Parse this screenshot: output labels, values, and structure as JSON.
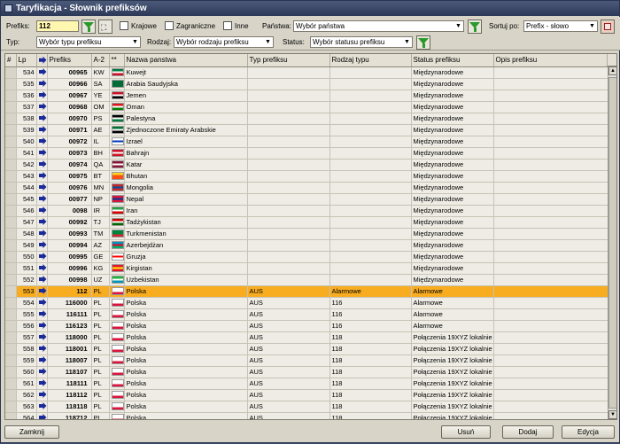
{
  "window": {
    "title": "Taryfikacja - Słownik prefiksów"
  },
  "filters": {
    "prefix_label": "Prefiks:",
    "prefix_value": "112",
    "krajowe_label": "Krajowe",
    "zagraniczne_label": "Zagraniczne",
    "inne_label": "Inne",
    "panstwa_label": "Państwa:",
    "panstwa_value": "Wybór państwa",
    "sortuj_label": "Sortuj po:",
    "sortuj_value": "Prefix - słowo",
    "typ_label": "Typ:",
    "typ_value": "Wybór typu prefiksu",
    "rodzaj_label": "Rodzaj:",
    "rodzaj_value": "Wybór rodzaju prefiksu",
    "status_label": "Status:",
    "status_value": "Wybór statusu prefiksu"
  },
  "table": {
    "columns": [
      "#",
      "Lp",
      "",
      "Prefiks",
      "A-2",
      "**",
      "Nazwa panstwa",
      "Typ prefiksu",
      "Rodzaj typu",
      "Status prefiksu",
      "Opis prefiksu"
    ],
    "rows": [
      {
        "lp": "534",
        "prefix": "00965",
        "a2": "KW",
        "flag": "kw",
        "country": "Kuwejt",
        "typ": "",
        "rodzaj": "",
        "status": "Międzynarodowe",
        "opis": ""
      },
      {
        "lp": "535",
        "prefix": "00966",
        "a2": "SA",
        "flag": "sa",
        "country": "Arabia Saudyjska",
        "typ": "",
        "rodzaj": "",
        "status": "Międzynarodowe",
        "opis": ""
      },
      {
        "lp": "536",
        "prefix": "00967",
        "a2": "YE",
        "flag": "ye",
        "country": "Jemen",
        "typ": "",
        "rodzaj": "",
        "status": "Międzynarodowe",
        "opis": ""
      },
      {
        "lp": "537",
        "prefix": "00968",
        "a2": "OM",
        "flag": "om",
        "country": "Oman",
        "typ": "",
        "rodzaj": "",
        "status": "Międzynarodowe",
        "opis": ""
      },
      {
        "lp": "538",
        "prefix": "00970",
        "a2": "PS",
        "flag": "ps",
        "country": "Palestyna",
        "typ": "",
        "rodzaj": "",
        "status": "Międzynarodowe",
        "opis": ""
      },
      {
        "lp": "539",
        "prefix": "00971",
        "a2": "AE",
        "flag": "ae",
        "country": "Zjednoczone Emiraty Arabskie",
        "typ": "",
        "rodzaj": "",
        "status": "Międzynarodowe",
        "opis": ""
      },
      {
        "lp": "540",
        "prefix": "00972",
        "a2": "IL",
        "flag": "il",
        "country": "Izrael",
        "typ": "",
        "rodzaj": "",
        "status": "Międzynarodowe",
        "opis": ""
      },
      {
        "lp": "541",
        "prefix": "00973",
        "a2": "BH",
        "flag": "bh",
        "country": "Bahrajn",
        "typ": "",
        "rodzaj": "",
        "status": "Międzynarodowe",
        "opis": ""
      },
      {
        "lp": "542",
        "prefix": "00974",
        "a2": "QA",
        "flag": "qa",
        "country": "Katar",
        "typ": "",
        "rodzaj": "",
        "status": "Międzynarodowe",
        "opis": ""
      },
      {
        "lp": "543",
        "prefix": "00975",
        "a2": "BT",
        "flag": "bt",
        "country": "Bhutan",
        "typ": "",
        "rodzaj": "",
        "status": "Międzynarodowe",
        "opis": ""
      },
      {
        "lp": "544",
        "prefix": "00976",
        "a2": "MN",
        "flag": "mn",
        "country": "Mongolia",
        "typ": "",
        "rodzaj": "",
        "status": "Międzynarodowe",
        "opis": ""
      },
      {
        "lp": "545",
        "prefix": "00977",
        "a2": "NP",
        "flag": "np",
        "country": "Nepal",
        "typ": "",
        "rodzaj": "",
        "status": "Międzynarodowe",
        "opis": ""
      },
      {
        "lp": "546",
        "prefix": "0098",
        "a2": "IR",
        "flag": "ir",
        "country": "Iran",
        "typ": "",
        "rodzaj": "",
        "status": "Międzynarodowe",
        "opis": ""
      },
      {
        "lp": "547",
        "prefix": "00992",
        "a2": "TJ",
        "flag": "tj",
        "country": "Tadżykistan",
        "typ": "",
        "rodzaj": "",
        "status": "Międzynarodowe",
        "opis": ""
      },
      {
        "lp": "548",
        "prefix": "00993",
        "a2": "TM",
        "flag": "tm",
        "country": "Turkmenistan",
        "typ": "",
        "rodzaj": "",
        "status": "Międzynarodowe",
        "opis": ""
      },
      {
        "lp": "549",
        "prefix": "00994",
        "a2": "AZ",
        "flag": "az",
        "country": "Azerbejdżan",
        "typ": "",
        "rodzaj": "",
        "status": "Międzynarodowe",
        "opis": ""
      },
      {
        "lp": "550",
        "prefix": "00995",
        "a2": "GE",
        "flag": "ge",
        "country": "Gruzja",
        "typ": "",
        "rodzaj": "",
        "status": "Międzynarodowe",
        "opis": ""
      },
      {
        "lp": "551",
        "prefix": "00996",
        "a2": "KG",
        "flag": "kg",
        "country": "Kirgistan",
        "typ": "",
        "rodzaj": "",
        "status": "Międzynarodowe",
        "opis": ""
      },
      {
        "lp": "552",
        "prefix": "00998",
        "a2": "UZ",
        "flag": "uz",
        "country": "Uzbekistan",
        "typ": "",
        "rodzaj": "",
        "status": "Międzynarodowe",
        "opis": ""
      },
      {
        "lp": "553",
        "prefix": "112",
        "a2": "PL",
        "flag": "pl",
        "country": "Polska",
        "typ": "AUS",
        "rodzaj": "Alarmowe",
        "status": "Alarmowe",
        "opis": "",
        "selected": true
      },
      {
        "lp": "554",
        "prefix": "116000",
        "a2": "PL",
        "flag": "pl",
        "country": "Polska",
        "typ": "AUS",
        "rodzaj": "116",
        "status": "Alarmowe",
        "opis": ""
      },
      {
        "lp": "555",
        "prefix": "116111",
        "a2": "PL",
        "flag": "pl",
        "country": "Polska",
        "typ": "AUS",
        "rodzaj": "116",
        "status": "Alarmowe",
        "opis": ""
      },
      {
        "lp": "556",
        "prefix": "116123",
        "a2": "PL",
        "flag": "pl",
        "country": "Polska",
        "typ": "AUS",
        "rodzaj": "116",
        "status": "Alarmowe",
        "opis": ""
      },
      {
        "lp": "557",
        "prefix": "118000",
        "a2": "PL",
        "flag": "pl",
        "country": "Polska",
        "typ": "AUS",
        "rodzaj": "118",
        "status": "Połączenia 19XYZ lokalnie",
        "opis": ""
      },
      {
        "lp": "558",
        "prefix": "118001",
        "a2": "PL",
        "flag": "pl",
        "country": "Polska",
        "typ": "AUS",
        "rodzaj": "118",
        "status": "Połączenia 19XYZ lokalnie",
        "opis": ""
      },
      {
        "lp": "559",
        "prefix": "118007",
        "a2": "PL",
        "flag": "pl",
        "country": "Polska",
        "typ": "AUS",
        "rodzaj": "118",
        "status": "Połączenia 19XYZ lokalnie",
        "opis": ""
      },
      {
        "lp": "560",
        "prefix": "118107",
        "a2": "PL",
        "flag": "pl",
        "country": "Polska",
        "typ": "AUS",
        "rodzaj": "118",
        "status": "Połączenia 19XYZ lokalnie",
        "opis": ""
      },
      {
        "lp": "561",
        "prefix": "118111",
        "a2": "PL",
        "flag": "pl",
        "country": "Polska",
        "typ": "AUS",
        "rodzaj": "118",
        "status": "Połączenia 19XYZ lokalnie",
        "opis": ""
      },
      {
        "lp": "562",
        "prefix": "118112",
        "a2": "PL",
        "flag": "pl",
        "country": "Polska",
        "typ": "AUS",
        "rodzaj": "118",
        "status": "Połączenia 19XYZ lokalnie",
        "opis": ""
      },
      {
        "lp": "563",
        "prefix": "118118",
        "a2": "PL",
        "flag": "pl",
        "country": "Polska",
        "typ": "AUS",
        "rodzaj": "118",
        "status": "Połączenia 19XYZ lokalnie",
        "opis": ""
      },
      {
        "lp": "564",
        "prefix": "118712",
        "a2": "PL",
        "flag": "pl",
        "country": "Polska",
        "typ": "AUS",
        "rodzaj": "118",
        "status": "Połączenia 19XYZ lokalnie",
        "opis": ""
      },
      {
        "lp": "565",
        "prefix": "118800",
        "a2": "PL",
        "flag": "pl",
        "country": "Polska",
        "typ": "AUS",
        "rodzaj": "118",
        "status": "Połączenia 19XYZ lokalnie",
        "opis": ""
      }
    ]
  },
  "flag_colors": {
    "kw": [
      "#007a3d",
      "#ffffff",
      "#ce1126"
    ],
    "sa": [
      "#006c35",
      "#006c35",
      "#006c35"
    ],
    "ye": [
      "#ce1126",
      "#ffffff",
      "#000000"
    ],
    "om": [
      "#db161b",
      "#ffffff",
      "#008000"
    ],
    "ps": [
      "#000000",
      "#ffffff",
      "#007a3d"
    ],
    "ae": [
      "#00732f",
      "#ffffff",
      "#000000"
    ],
    "il": [
      "#ffffff",
      "#0038b8",
      "#ffffff"
    ],
    "bh": [
      "#ce1126",
      "#ffffff",
      "#ce1126"
    ],
    "qa": [
      "#8a1538",
      "#ffffff",
      "#8a1538"
    ],
    "bt": [
      "#ffd520",
      "#ff4e12",
      "#ff4e12"
    ],
    "mn": [
      "#c4272f",
      "#015197",
      "#c4272f"
    ],
    "np": [
      "#dc143c",
      "#003893",
      "#dc143c"
    ],
    "ir": [
      "#239f40",
      "#ffffff",
      "#da0000"
    ],
    "tj": [
      "#cc0000",
      "#ffffff",
      "#006600"
    ],
    "tm": [
      "#00843d",
      "#00843d",
      "#d22630"
    ],
    "az": [
      "#0092bc",
      "#e4002b",
      "#00af66"
    ],
    "ge": [
      "#ffffff",
      "#ff0000",
      "#ffffff"
    ],
    "kg": [
      "#e8112d",
      "#ffef00",
      "#e8112d"
    ],
    "uz": [
      "#1eb53a",
      "#ffffff",
      "#0099b5"
    ],
    "pl": [
      "#ffffff",
      "#ffffff",
      "#dc143c"
    ]
  },
  "buttons": {
    "zamknij": "Zamknij",
    "usun": "Usuń",
    "dodaj": "Dodaj",
    "edycja": "Edycja"
  }
}
